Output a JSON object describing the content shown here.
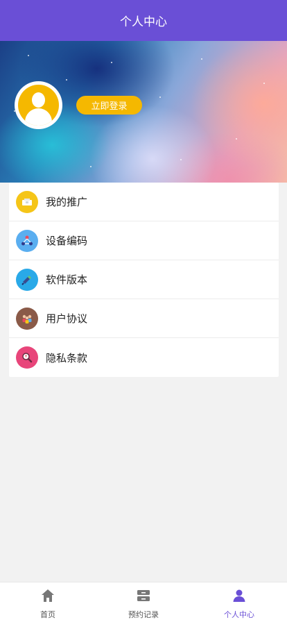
{
  "header": {
    "title": "个人中心"
  },
  "profile": {
    "login_label": "立即登录"
  },
  "menu": {
    "items": [
      {
        "label": "我的推广",
        "icon": "promotion-icon",
        "color": "#f5c518"
      },
      {
        "label": "设备编码",
        "icon": "device-code-icon",
        "color": "#5aaef0"
      },
      {
        "label": "软件版本",
        "icon": "software-version-icon",
        "color": "#29a9e8"
      },
      {
        "label": "用户协议",
        "icon": "user-agreement-icon",
        "color": "#8a5a48"
      },
      {
        "label": "隐私条款",
        "icon": "privacy-policy-icon",
        "color": "#e8457a"
      }
    ]
  },
  "tabbar": {
    "items": [
      {
        "label": "首页",
        "icon": "home-icon",
        "active": false
      },
      {
        "label": "预约记录",
        "icon": "records-icon",
        "active": false
      },
      {
        "label": "个人中心",
        "icon": "person-icon",
        "active": true
      }
    ]
  },
  "colors": {
    "primary": "#6a4fd6",
    "accent": "#f5b800"
  }
}
